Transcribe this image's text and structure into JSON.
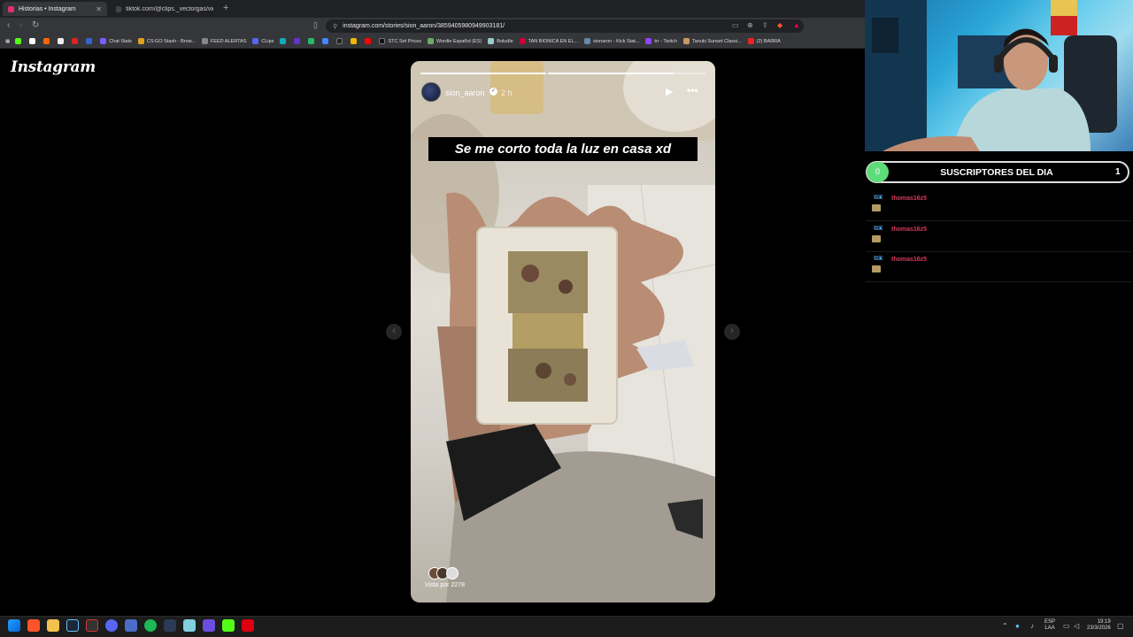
{
  "browser": {
    "tabs": [
      {
        "label": "Historias • Instagram",
        "active": true
      },
      {
        "label": "tiktok.com/@clips._vectorgas/video/",
        "active": false
      }
    ],
    "url": "instagram.com/stories/sion_aaron/3859405980949903181/",
    "bookmarks": [
      "Chat Stats",
      "CS:GO Stash - Brow...",
      "FEED ALERTAS",
      "CLips",
      "STC Set Prices",
      "Wordle Español (ES)",
      "Boludle",
      "TAN BIONICA EN EL...",
      "sionaron - Kick Stat...",
      "trr - Twitch",
      "Tanuki Sunset Classi...",
      "(2) BARRA"
    ]
  },
  "instagram": {
    "logo": "Instagram",
    "story": {
      "username": "sion_aaron",
      "time": "2 h",
      "caption": "Se me corto toda la luz en casa xd",
      "views_label": "Vista por 2278",
      "progress": [
        1.0,
        0.8
      ]
    }
  },
  "overlay": {
    "subs_title": "SUSCRIPTORES DEL DIA",
    "subs_count": "1",
    "subs_ball": "0",
    "chat": [
      {
        "name": "thomas16z5"
      },
      {
        "name": "thomas16z5"
      },
      {
        "name": "thomas16z5"
      }
    ]
  },
  "taskbar": {
    "lang_top": "ESP",
    "lang_bottom": "LAA",
    "time": "19:19",
    "date": "23/3/2026"
  },
  "colors": {
    "accent_green": "#5fdc7a",
    "chat_name": "#d63a5a",
    "chat_badge": "#5aa9ff"
  }
}
